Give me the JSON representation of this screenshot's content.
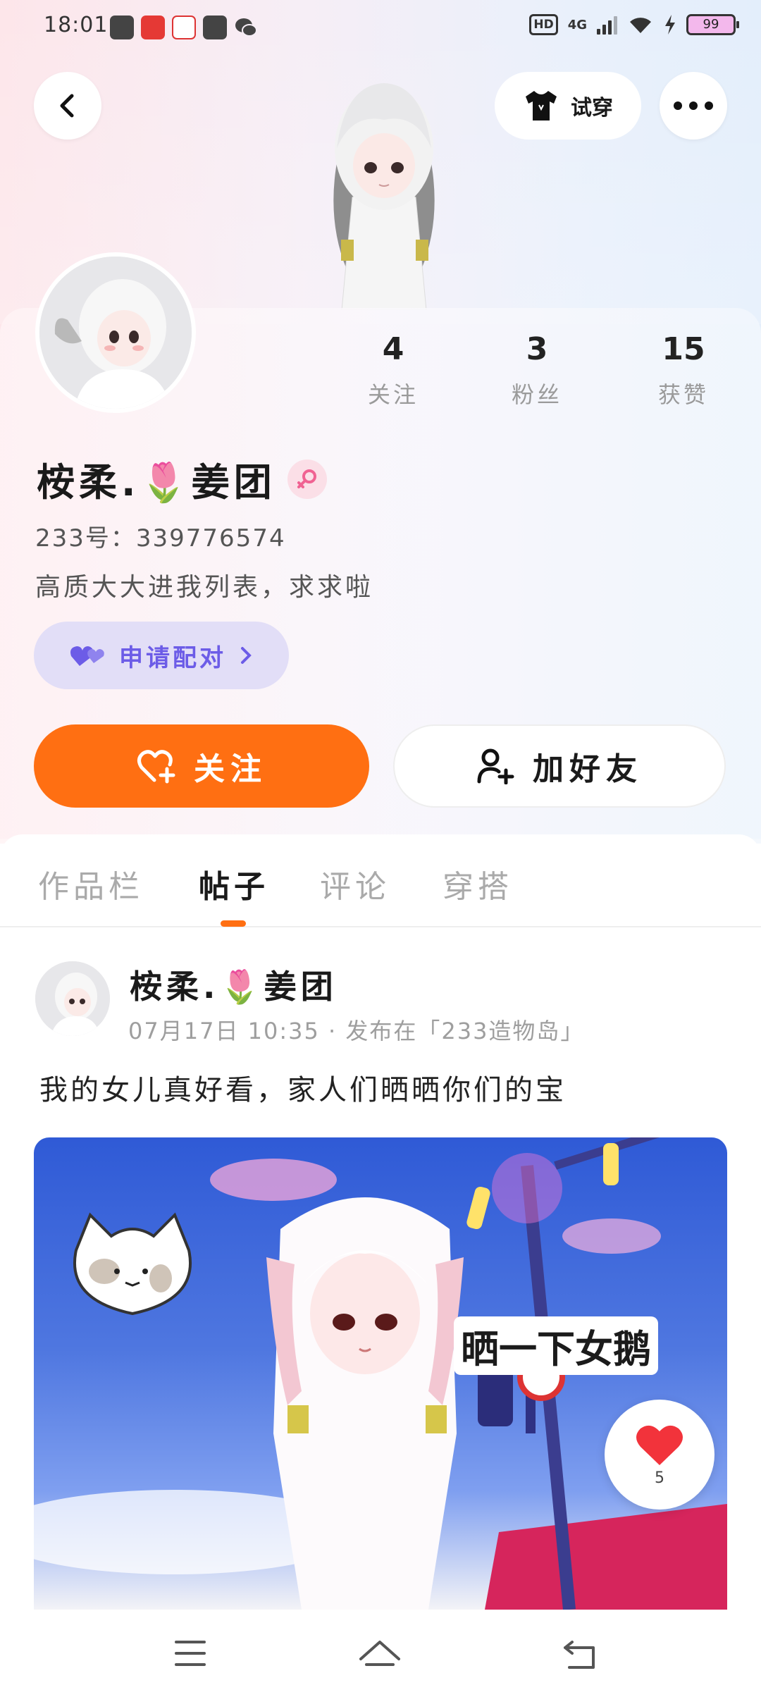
{
  "status_bar": {
    "time": "18:01",
    "battery": "99",
    "network": "4G",
    "hd": "HD"
  },
  "header": {
    "try_on_label": "试穿"
  },
  "profile": {
    "stats": [
      {
        "value": "4",
        "label": "关注"
      },
      {
        "value": "3",
        "label": "粉丝"
      },
      {
        "value": "15",
        "label": "获赞"
      }
    ],
    "nickname": "桉柔.🌷姜团",
    "uid": "233号：339776574",
    "bio": "高质大大进我列表，求求啦",
    "pair_label": "申请配对",
    "follow_label": "关注",
    "add_friend_label": "加好友"
  },
  "tabs": [
    {
      "label": "作品栏",
      "active": false
    },
    {
      "label": "帖子",
      "active": true
    },
    {
      "label": "评论",
      "active": false
    },
    {
      "label": "穿搭",
      "active": false
    }
  ],
  "post": {
    "author": "桉柔.🌷姜团",
    "meta": "07月17日 10:35 · 发布在「233造物岛」",
    "text": "我的女儿真好看，家人们晒晒你们的宝",
    "image_caption": "晒一下女鹅",
    "like_count": "5"
  },
  "colors": {
    "accent": "#ff6f12",
    "pair": "#6c5ce7",
    "pair_bg": "#e2def7"
  }
}
